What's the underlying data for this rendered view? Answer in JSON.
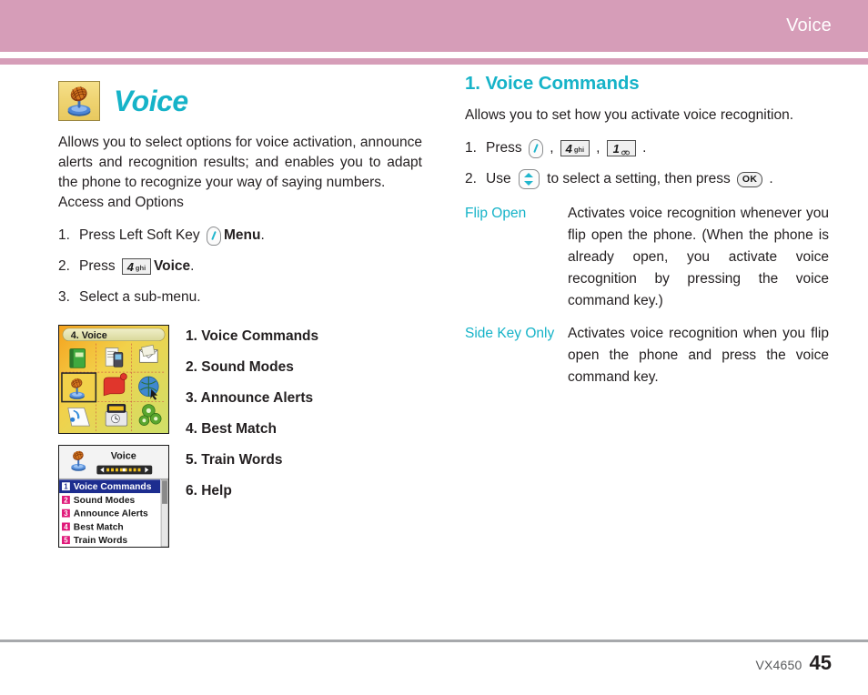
{
  "header": {
    "title": "Voice"
  },
  "left": {
    "section_title": "Voice",
    "section_icon": "microphone-icon",
    "intro": "Allows you to select options for voice activation, announce alerts and recognition results; and enables you to adapt the phone to recognize your way of saying numbers.",
    "subheading": "Access and Options",
    "steps": [
      {
        "num": "1.",
        "pre": "Press Left Soft Key ",
        "icon": "left-soft-key-icon",
        "post": "Menu",
        "post_tail": "."
      },
      {
        "num": "2.",
        "pre": "Press ",
        "key_digit": "4",
        "key_sub": "ghi",
        "post": "Voice",
        "post_tail": "."
      },
      {
        "num": "3.",
        "pre": "Select a sub-menu.",
        "post": "",
        "post_tail": ""
      }
    ],
    "menu_items": [
      "1. Voice Commands",
      "2. Sound Modes",
      "3. Announce Alerts",
      "4. Best Match",
      "5. Train Words",
      "6. Help"
    ],
    "screenshot_1": {
      "title": "4. Voice",
      "name": "phone-menu-grid-screenshot"
    },
    "screenshot_2": {
      "title": "Voice",
      "name": "phone-voice-menu-screenshot",
      "items": [
        {
          "num": "1",
          "label": "Voice Commands",
          "selected": true
        },
        {
          "num": "2",
          "label": "Sound Modes",
          "selected": false
        },
        {
          "num": "3",
          "label": "Announce Alerts",
          "selected": false
        },
        {
          "num": "4",
          "label": "Best Match",
          "selected": false
        },
        {
          "num": "5",
          "label": "Train Words",
          "selected": false
        }
      ]
    }
  },
  "right": {
    "heading": "1. Voice Commands",
    "intro": "Allows you to set how you activate voice recognition.",
    "step1": {
      "num": "1.",
      "label": "Press ",
      "sep1": " , ",
      "key_a_digit": "4",
      "key_a_sub": "ghi",
      "sep2": " , ",
      "key_b_digit": "1",
      "key_b_sub": "voicemail-glyph",
      "tail": " ."
    },
    "step2": {
      "num": "2.",
      "label": "Use ",
      "mid": " to select a setting, then press ",
      "ok_label": "OK",
      "tail": " ."
    },
    "definitions": [
      {
        "term": "Flip Open",
        "desc": "Activates voice recognition whenever you flip open the phone. (When the phone is already open, you activate voice recognition by pressing the voice command key.)"
      },
      {
        "term": "Side Key Only",
        "desc": "Activates voice recognition when you flip open the phone and press the voice command key."
      }
    ]
  },
  "footer": {
    "model": "VX4650",
    "page": "45"
  },
  "colors": {
    "header_pink": "#d69db8",
    "accent_teal": "#16b3c8",
    "body_text": "#231f20",
    "footer_gray": "#58595b",
    "rule_gray": "#a7a9ac"
  }
}
